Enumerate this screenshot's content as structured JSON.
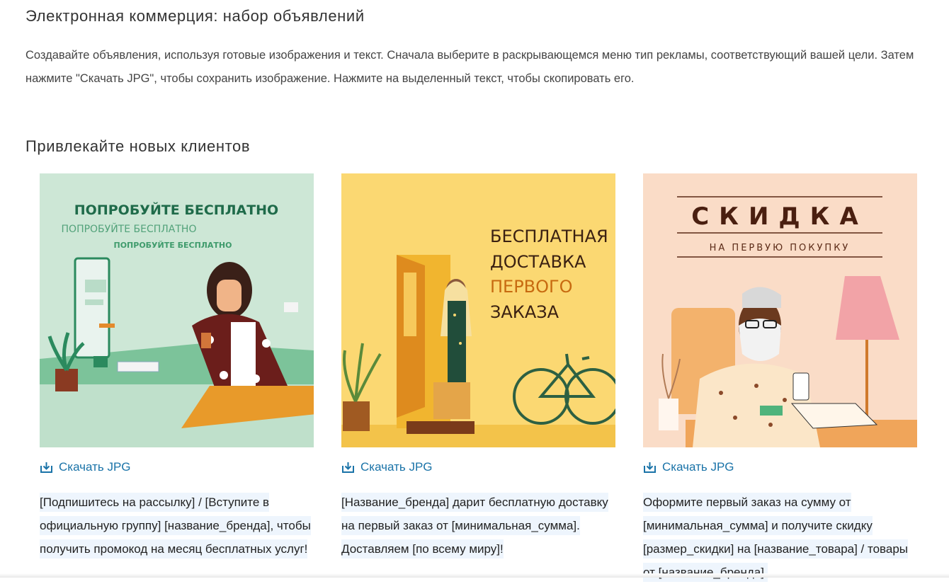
{
  "page": {
    "title": "Электронная коммерция: набор объявлений",
    "intro": "Создавайте объявления, используя готовые изображения и текст. Сначала выберите в раскрывающемся меню тип рекламы, соответствующий вашей цели. Затем нажмите \"Скачать JPG\", чтобы сохранить изображение. Нажмите на выделенный текст, чтобы скопировать его."
  },
  "section": {
    "title": "Привлекайте новых клиентов"
  },
  "cards": [
    {
      "image": {
        "headline_1": "ПОПРОБУЙТЕ БЕСПЛАТНО",
        "headline_2": "ПОПРОБУЙТЕ БЕСПЛАТНО",
        "headline_3": "ПОПРОБУЙТЕ БЕСПЛАТНО"
      },
      "download_label": "Скачать JPG",
      "ad_text": "[Подпишитесь на рассылку] / [Вступите в официальную группу] [название_бренда], чтобы получить промокод на месяц бесплатных услуг!"
    },
    {
      "image": {
        "line_1": "БЕСПЛАТНАЯ",
        "line_2": "ДОСТАВКА",
        "line_3": "ПЕРВОГО",
        "line_4": "ЗАКАЗА"
      },
      "download_label": "Скачать JPG",
      "ad_text": "[Название_бренда] дарит бесплатную доставку на первый заказ от [минимальная_сумма]. Доставляем [по всему миру]!"
    },
    {
      "image": {
        "headline": "СКИДКА",
        "subline": "НА ПЕРВУЮ ПОКУПКУ"
      },
      "download_label": "Скачать JPG",
      "ad_text": "Оформите первый заказ на сумму от [минимальная_сумма] и получите скидку [размер_скидки] на [название_товара] / товары от [название_бренда]."
    }
  ],
  "colors": {
    "link": "#1a73a8",
    "highlight": "#eef5fd",
    "card1_bg": "#cde7d6",
    "card2_bg": "#fbd872",
    "card3_bg": "#fadcc7"
  },
  "icons": {
    "download": "download-icon"
  }
}
